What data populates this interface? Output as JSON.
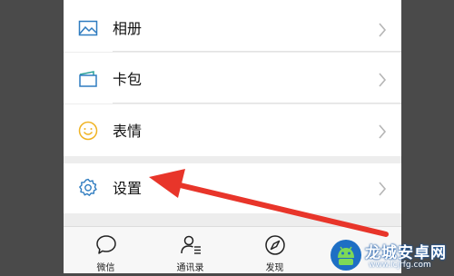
{
  "menu": {
    "items": [
      {
        "label": "相册",
        "icon": "album-icon"
      },
      {
        "label": "卡包",
        "icon": "card-wallet-icon"
      },
      {
        "label": "表情",
        "icon": "smiley-icon"
      },
      {
        "label": "设置",
        "icon": "gear-icon"
      }
    ]
  },
  "tabbar": {
    "tabs": [
      {
        "label": "微信",
        "icon": "chat-bubble-icon"
      },
      {
        "label": "通讯录",
        "icon": "contacts-icon"
      },
      {
        "label": "发现",
        "icon": "compass-icon"
      }
    ]
  },
  "annotation": {
    "type": "red-arrow",
    "color": "#e8352a",
    "points_to": "设置"
  },
  "watermark": {
    "title": "龙城安卓网",
    "url": "www.lcjrfg.com"
  },
  "colors": {
    "background_dark": "#4a4a4a",
    "accent_blue": "#2f7cc0",
    "arrow_red": "#e8352a"
  }
}
